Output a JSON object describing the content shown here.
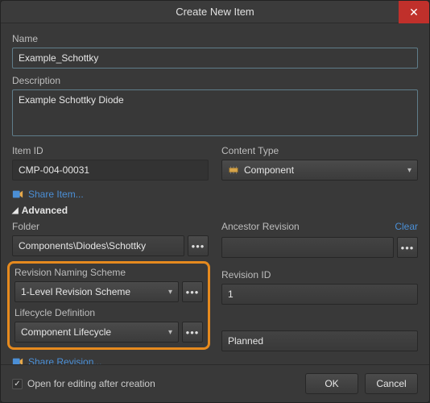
{
  "window": {
    "title": "Create New Item"
  },
  "labels": {
    "name": "Name",
    "description": "Description",
    "item_id": "Item ID",
    "content_type": "Content Type",
    "folder": "Folder",
    "ancestor_revision": "Ancestor Revision",
    "revision_naming_scheme": "Revision Naming Scheme",
    "lifecycle_definition": "Lifecycle Definition",
    "revision_id": "Revision ID"
  },
  "values": {
    "name": "Example_Schottky",
    "description": "Example Schottky Diode",
    "item_id": "CMP-004-00031",
    "content_type": "Component",
    "folder": "Components\\Diodes\\Schottky",
    "ancestor_revision": "",
    "revision_naming_scheme": "1-Level Revision Scheme",
    "lifecycle_definition": "Component Lifecycle",
    "revision_id": "1",
    "revision_state": "Planned"
  },
  "links": {
    "share_item": "Share Item...",
    "share_revision": "Share Revision...",
    "clear": "Clear"
  },
  "sections": {
    "advanced": "Advanced"
  },
  "footer": {
    "open_for_editing": "Open for editing after creation",
    "open_checked": true,
    "ok": "OK",
    "cancel": "Cancel"
  },
  "glyphs": {
    "more": "•••",
    "close": "✕",
    "check": "✓",
    "caret": "▾",
    "tri": "◢"
  }
}
